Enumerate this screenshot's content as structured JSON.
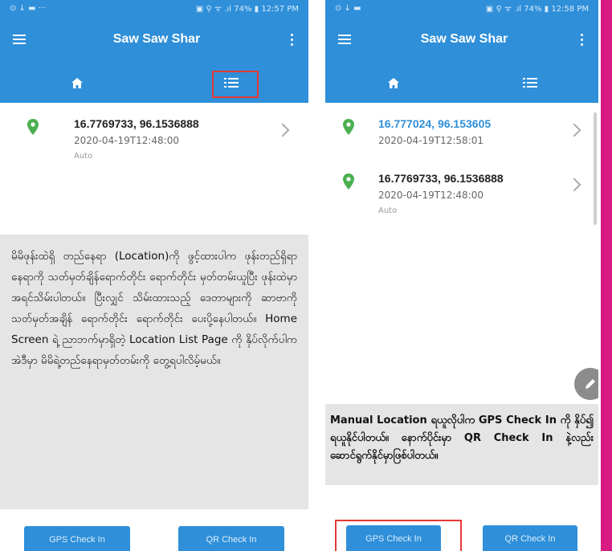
{
  "app": {
    "title": "Saw Saw Shar",
    "accent": "#2f8fd9",
    "highlight": "#e53935"
  },
  "screens": [
    {
      "status": {
        "left": "⊙ ↓ ▬ ···",
        "right": "▣ ⚲ ᯤ .ıl 74% ▮ 12:57 PM"
      },
      "tabs": [
        {
          "icon": "home-icon"
        },
        {
          "icon": "list-icon",
          "highlighted": true
        }
      ],
      "items": [
        {
          "coords": "16.7769733, 96.1536888",
          "date": "2020-04-19T12:48:00",
          "mode": "Auto"
        }
      ],
      "caption": "မိမိဖုန်းထဲရှိ တည်နေရာ (Location)ကို ဖွင့်ထားပါက ဖုန်းတည်ရှိရာနေရာကို သတ်မှတ်ချိန်ရောက်တိုင်း ရောက်တိုင်း မှတ်တမ်းယူပြီး ဖုန်းထဲမှာ အရင်သိမ်းပါတယ်။ ပြီးလျှင် သိမ်းထားသည့် ဒေတာများကို ဆာဗာကို သတ်မှတ်အချိန် ရောက်တိုင်း ရောက်တိုင်း ပေးပို့နေပါတယ်။ Home Screen ရဲ့ ညာဘက်မှာရှိတဲ့ Location List Page ကို နှိပ်လိုက်ပါက အဲဒီမှာ မိမိရဲ့တည်နေရာမှတ်တမ်းကို တွေ့ရပါလိမ့်မယ်။",
      "buttons": {
        "gps": "GPS Check In",
        "qr": "QR Check In"
      }
    },
    {
      "status": {
        "left": "⊙ ↓ ▬",
        "right": "▣ ⚲ ᯤ .ıl 74% ▮ 12:58 PM"
      },
      "tabs": [
        {
          "icon": "home-icon"
        },
        {
          "icon": "list-icon"
        }
      ],
      "items": [
        {
          "coords": "16.777024, 96.153605",
          "date": "2020-04-19T12:58:01",
          "mode": "",
          "coords_color": "#2f8fd9"
        },
        {
          "coords": "16.7769733, 96.1536888",
          "date": "2020-04-19T12:48:00",
          "mode": "Auto"
        }
      ],
      "caption": "Manual Location ရယူလိုပါက GPS Check In ကို နှိပ်၍ ရယူနိုင်ပါတယ်။ နောက်ပိုင်းမှာ QR Check In နဲ့လည်း ဆောင်ရွက်နိုင်မှာဖြစ်ပါတယ်။",
      "buttons": {
        "gps": "GPS Check In",
        "qr": "QR Check In"
      },
      "fab_icon": "edit-pencil-icon"
    }
  ]
}
